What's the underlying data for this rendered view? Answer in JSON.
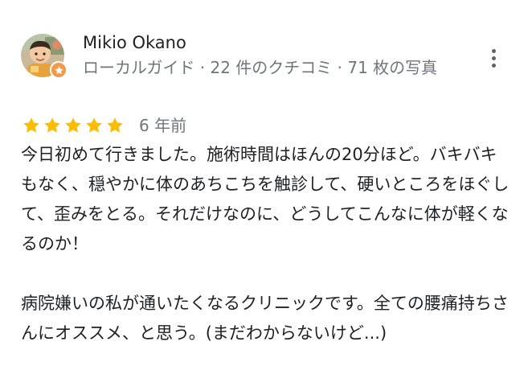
{
  "reviewer": {
    "name": "Mikio Okano",
    "meta": "ローカルガイド · 22 件のクチコミ · 71 枚の写真"
  },
  "review": {
    "rating": 5,
    "rating_max": 5,
    "date": "6 年前",
    "paragraph_1": "今日初めて行きました。施術時間はほんの20分ほど。バキバキもなく、穏やかに体のあちこちを触診して、硬いところをほぐして、歪みをとる。それだけなのに、どうしてこんなに体が軽くなるのか！",
    "paragraph_2": "病院嫌いの私が通いたくなるクリニックです。全ての腰痛持ちさんにオススメ、と思う。(まだわからないけど...)"
  },
  "icons": {
    "avatar": "avatar-icon",
    "badge": "local-guide-star-icon",
    "menu": "more-vert-icon",
    "star": "star-icon"
  },
  "colors": {
    "star": "#fbbc04",
    "badge": "#f2994a",
    "meta_text": "#70757a",
    "body_text": "#202124"
  }
}
